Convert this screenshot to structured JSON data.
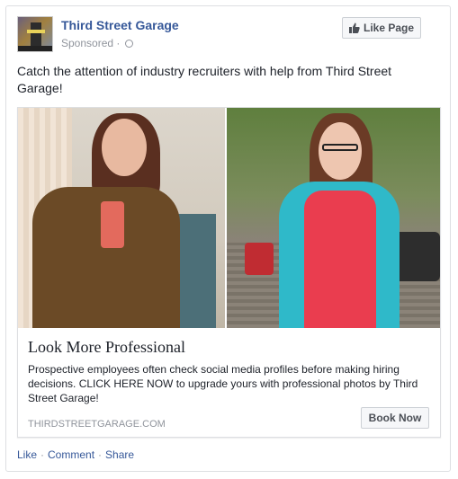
{
  "post": {
    "page_name": "Third Street Garage",
    "sponsored_label": "Sponsored",
    "dot": "·",
    "like_page_label": "Like Page",
    "text": "Catch the attention of industry recruiters with help from Third Street Garage!"
  },
  "link": {
    "title": "Look More Professional",
    "description": "Prospective employees often check social media profiles before making hiring decisions. CLICK HERE NOW to upgrade yours with professional photos by Third Street Garage!",
    "domain": "THIRDSTREETGARAGE.COM",
    "cta_label": "Book Now"
  },
  "actions": {
    "like": "Like",
    "comment": "Comment",
    "share": "Share",
    "separator": "·"
  },
  "icons": {
    "like_page": "thumbs-up-icon",
    "privacy": "globe-icon"
  },
  "colors": {
    "link_blue": "#365899",
    "meta_gray": "#90949c",
    "button_bg": "#f6f7f9"
  }
}
